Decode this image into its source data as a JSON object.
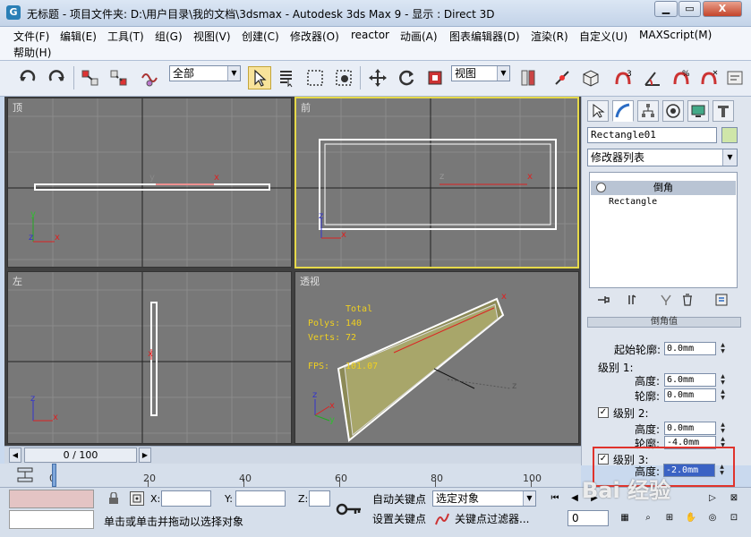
{
  "window": {
    "title": "无标题      - 项目文件夹: D:\\用户目录\\我的文档\\3dsmax      - Autodesk 3ds Max 9      - 显示 : Direct 3D",
    "icon_letter": "G",
    "min": "▁",
    "max": "▭",
    "close": "X"
  },
  "menu": [
    "文件(F)",
    "编辑(E)",
    "工具(T)",
    "组(G)",
    "视图(V)",
    "创建(C)",
    "修改器(O)",
    "reactor",
    "动画(A)",
    "图表编辑器(D)",
    "渲染(R)",
    "自定义(U)",
    "MAXScript(M)",
    "帮助(H)"
  ],
  "toolbar": {
    "selection_filter": "全部",
    "ref_coord": "视图"
  },
  "viewports": {
    "top": "顶",
    "front": "前",
    "left": "左",
    "persp": "透视"
  },
  "stats": {
    "total": "Total",
    "polys_label": "Polys:",
    "polys": "140",
    "verts_label": "Verts:",
    "verts": "72",
    "fps_label": "FPS:",
    "fps": "101.07"
  },
  "axes": {
    "x": "x",
    "y": "y",
    "z": "z"
  },
  "command_panel": {
    "object_name": "Rectangle01",
    "modifier_list": "修改器列表",
    "stack": [
      "倒角",
      "Rectangle"
    ],
    "rollout_title": "倒角值",
    "params": {
      "start_outline_label": "起始轮廓:",
      "start_outline": "0.0mm",
      "level1": "级别 1:",
      "height_label": "高度:",
      "outline_label": "轮廓:",
      "l1_height": "6.0mm",
      "l1_outline": "0.0mm",
      "level2": "级别 2:",
      "l2_height": "0.0mm",
      "l2_outline": "-4.0mm",
      "level3": "级别 3:",
      "l3_height": "-2.0mm",
      "check": "✓"
    }
  },
  "timeline": {
    "frame_display": "0 / 100",
    "ticks": [
      "0",
      "20",
      "40",
      "60",
      "80",
      "100"
    ]
  },
  "status": {
    "x_label": "X:",
    "y_label": "Y:",
    "z_label": "Z:",
    "prompt": "单击或单击并拖动以选择对象",
    "auto_key": "自动关键点",
    "set_key": "设置关键点",
    "selected_dropdown": "选定对象",
    "key_filter": "关键点过滤器...",
    "frame": "0"
  },
  "watermark": "Bai 经验"
}
